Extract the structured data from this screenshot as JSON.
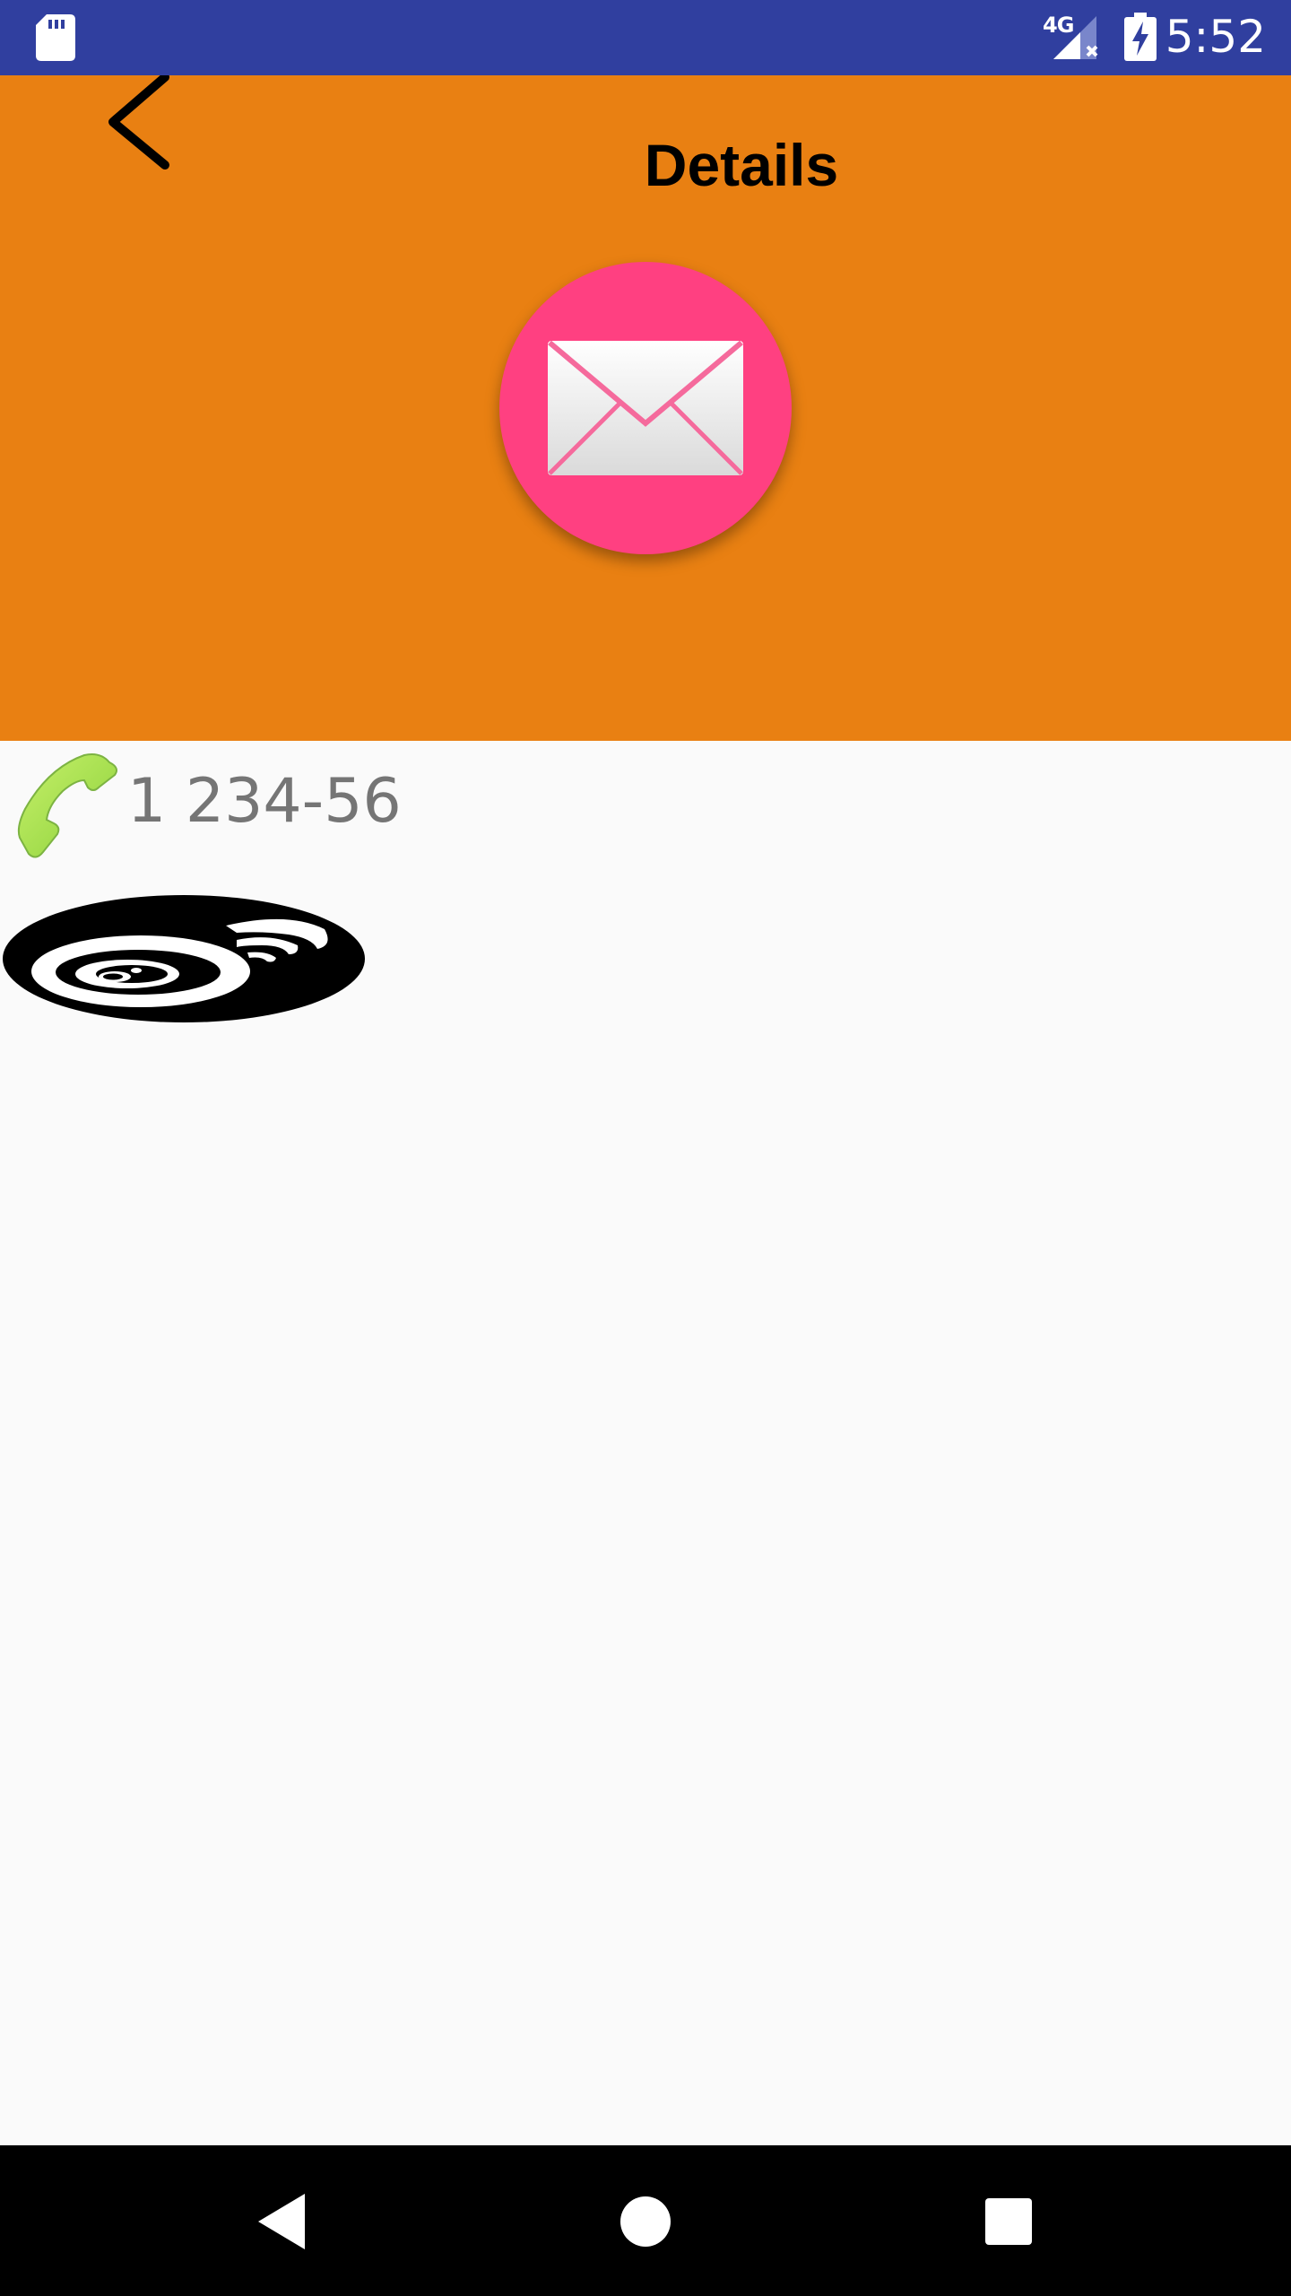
{
  "status_bar": {
    "network_label": "4G",
    "time": "5:52",
    "background_color": "#303F9F",
    "icons": [
      "sd-card-icon",
      "cellular-signal-icon",
      "battery-charging-icon"
    ]
  },
  "header": {
    "title": "Details",
    "background_color": "#E98012",
    "back_icon": "chevron-left-icon",
    "fab_icon": "envelope-icon",
    "fab_color": "#FF4081"
  },
  "contact": {
    "phone_icon": "phone-handset-icon",
    "phone_number": "1 234-56",
    "social_icon": "weibo-icon"
  },
  "nav_bar": {
    "icons": [
      "nav-back-icon",
      "nav-home-icon",
      "nav-recents-icon"
    ]
  }
}
